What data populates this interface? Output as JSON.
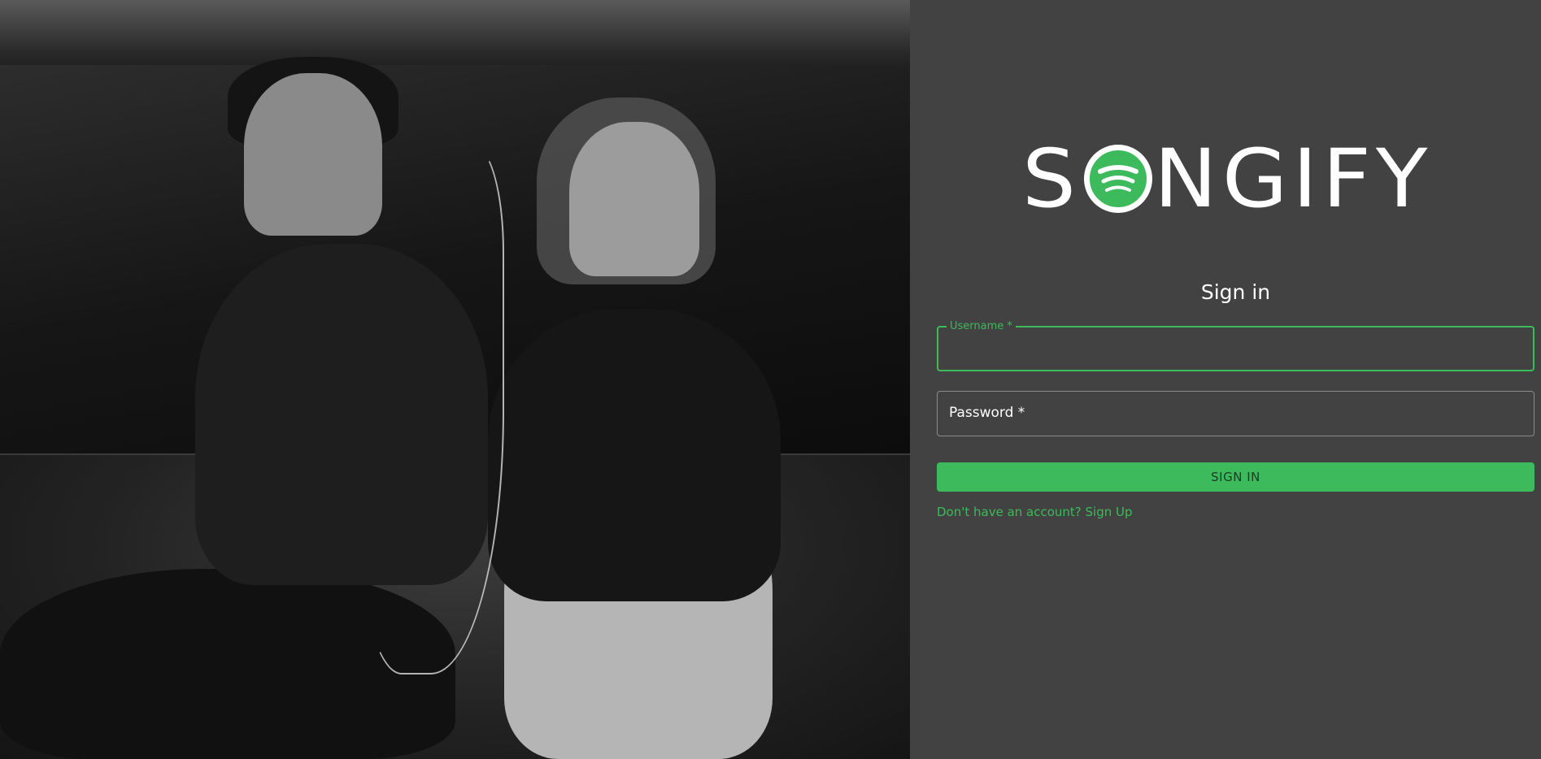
{
  "app": {
    "brand_name": "SONGIFY",
    "brand_letters_before": "S",
    "brand_letters_after": "NGIFY",
    "brand_color": "#3dba5b",
    "background_color": "#424242"
  },
  "hero_image": {
    "icon": "photo-couple-listening-music"
  },
  "signin": {
    "title": "Sign in",
    "username_label": "Username *",
    "username_value": "",
    "password_label": "Password *",
    "password_value": "",
    "submit_label": "SIGN IN",
    "signup_link": "Don't have an account? Sign Up"
  }
}
